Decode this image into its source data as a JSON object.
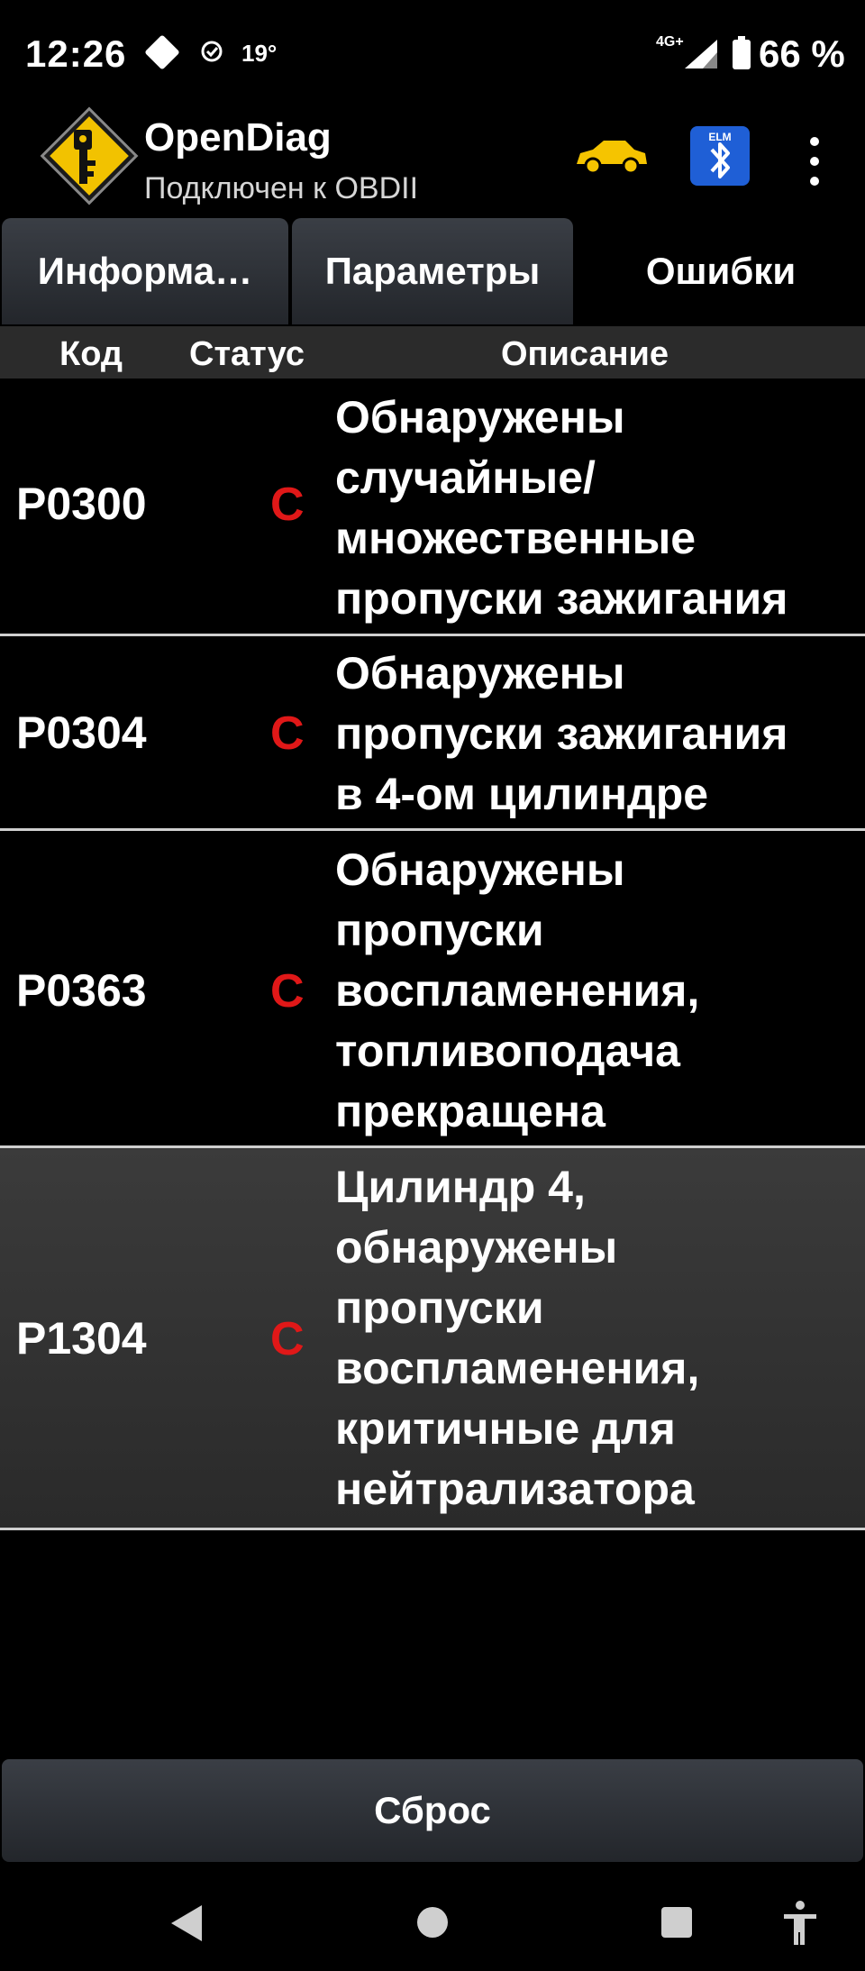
{
  "status_bar": {
    "time": "12:26",
    "temperature": "19°",
    "network": "4G+",
    "battery": "66 %"
  },
  "app_bar": {
    "title": "OpenDiag",
    "subtitle": "Подключен к OBDII",
    "icons": [
      "app-logo-icon",
      "car-icon",
      "bluetooth-icon",
      "overflow-menu-icon"
    ]
  },
  "tabs": [
    {
      "label": "Информа…",
      "active": false
    },
    {
      "label": "Параметры",
      "active": false
    },
    {
      "label": "Ошибки",
      "active": true
    }
  ],
  "columns": {
    "code": "Код",
    "status": "Статус",
    "description": "Описание"
  },
  "errors": [
    {
      "code": "P0300",
      "status": "C",
      "lines": [
        "Обнаружены",
        "случайные/",
        "множественные",
        "пропуски зажигания"
      ]
    },
    {
      "code": "P0304",
      "status": "C",
      "lines": [
        "Обнаружены",
        "пропуски зажигания",
        "в 4-ом цилиндре"
      ]
    },
    {
      "code": "P0363",
      "status": "C",
      "lines": [
        "Обнаружены",
        "пропуски",
        "воспламенения,",
        "топливоподача",
        "прекращена"
      ]
    },
    {
      "code": "P1304",
      "status": "C",
      "selected": true,
      "lines": [
        "Цилиндр 4,",
        "обнаружены",
        "пропуски",
        "воспламенения,",
        "критичные для",
        "нейтрализатора"
      ]
    }
  ],
  "footer": {
    "reset_label": "Сброс"
  },
  "colors": {
    "status_red": "#e01818",
    "logo_yellow": "#f2c200",
    "car_yellow": "#f5c400",
    "bluetooth_blue": "#1f5fd6"
  }
}
